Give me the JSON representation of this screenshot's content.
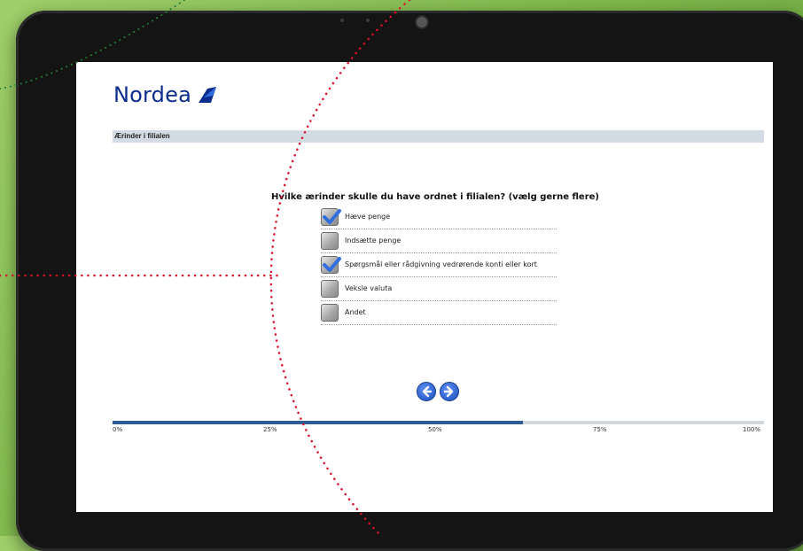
{
  "brand": {
    "name": "Nordea"
  },
  "section": {
    "title": "Ærinder i filialen"
  },
  "survey": {
    "question": "Hvilke ærinder skulle du have ordnet i filialen? (vælg gerne flere)",
    "options": [
      {
        "label": "Hæve penge",
        "checked": true
      },
      {
        "label": "Indsætte penge",
        "checked": false
      },
      {
        "label": "Spørgsmål eller rådgivning vedrørende konti eller kort",
        "checked": true
      },
      {
        "label": "Veksle valuta",
        "checked": false
      },
      {
        "label": "Andet",
        "checked": false
      }
    ]
  },
  "navigation": {
    "back": "back-arrow-icon",
    "next": "forward-arrow-icon"
  },
  "progress": {
    "value_percent": 63,
    "ticks": [
      "0%",
      "25%",
      "50%",
      "75%",
      "100%"
    ]
  },
  "colors": {
    "brand_blue": "#0a2d8e",
    "progress_fill": "#2e5a96",
    "check_blue": "#2f6fe0",
    "annotation_dots": "#d8102a"
  }
}
